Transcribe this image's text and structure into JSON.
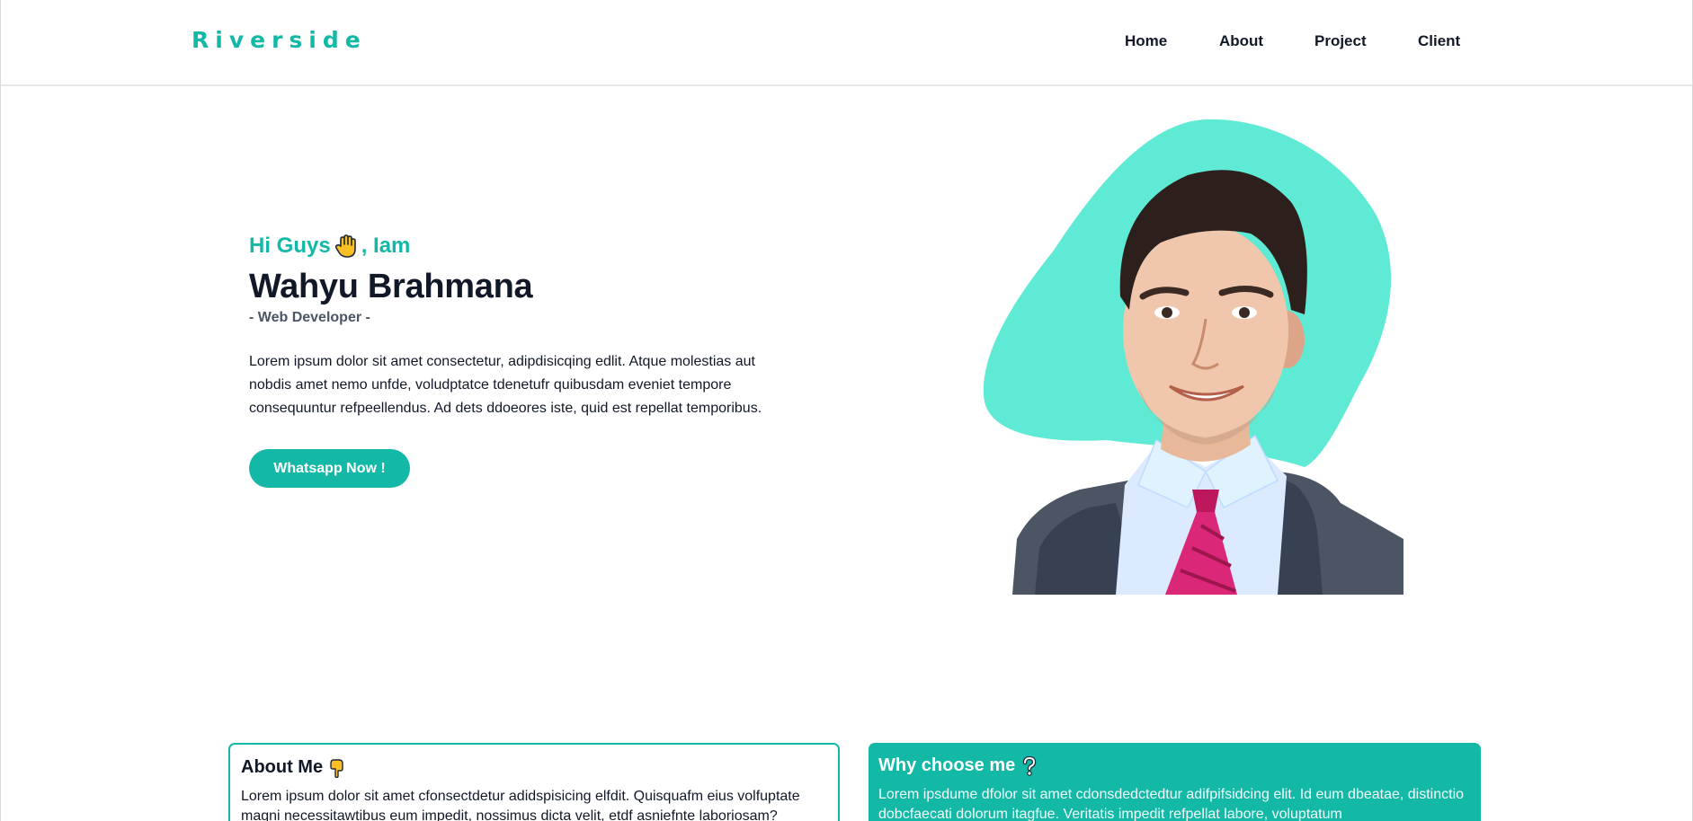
{
  "brand": {
    "name": "Riverside"
  },
  "nav": {
    "items": [
      {
        "label": "Home"
      },
      {
        "label": "About"
      },
      {
        "label": "Project"
      },
      {
        "label": "Client"
      }
    ]
  },
  "hero": {
    "greeting_prefix": "Hi Guys",
    "greeting_suffix": ", Iam",
    "name": "Wahyu Brahmana",
    "role": "- Web Developer -",
    "description": "Lorem ipsum dolor sit amet consectetur, adipdisicqing edlit. Atque molestias aut nobdis amet nemo unfde, voludptatce tdenetufr quibusdam eveniet tempore consequuntur refpeellendus. Ad dets ddoeores iste, quid est repellat temporibus.",
    "cta_label": "Whatsapp Now !"
  },
  "about_card": {
    "title": "About Me",
    "body": "Lorem ipsum dolor sit amet cfonsectdetur adidspisicing elfdit. Quisquafm eius volfuptate magni necessitawtibus eum impedit, nossimus dicta velit, etdf asniefnte laboriosam?"
  },
  "why_card": {
    "title": "Why choose me",
    "body": "Lorem ipsdume dfolor sit amet cdonsdedctedtur adifpifsidcing elit. Id eum dbeatae, distinctio dobcfaecati dolorum itagfue. Veritatis impedit refpellat labore, voluptatum"
  },
  "colors": {
    "accent": "#14b8a6",
    "blob": "#5eead4",
    "text": "#111827"
  },
  "icons": [
    "raised-hand-icon",
    "pointing-down-icon",
    "question-mark-icon"
  ]
}
